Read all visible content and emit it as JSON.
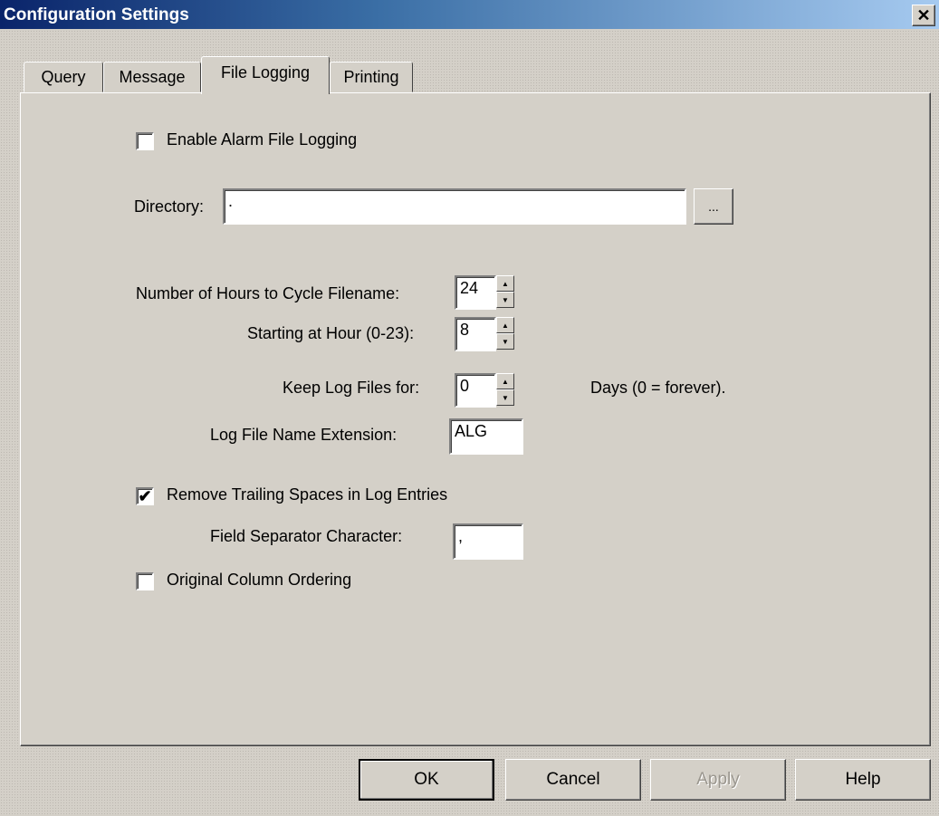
{
  "window": {
    "title": "Configuration Settings",
    "close_icon_glyph": "✕"
  },
  "tabs": [
    {
      "label": "Query",
      "active": false
    },
    {
      "label": "Message",
      "active": false
    },
    {
      "label": "File Logging",
      "active": true
    },
    {
      "label": "Printing",
      "active": false
    }
  ],
  "file_logging": {
    "enable_alarm_file_logging": {
      "label": "Enable Alarm File Logging",
      "checked": false
    },
    "directory": {
      "label": "Directory:",
      "value": ".",
      "browse_label": "..."
    },
    "cycle_hours": {
      "label": "Number of Hours to Cycle Filename:",
      "value": "24"
    },
    "starting_hour": {
      "label": "Starting at Hour (0-23):",
      "value": "8"
    },
    "keep_log_files": {
      "label": "Keep Log Files for:",
      "value": "0",
      "suffix": "Days (0 = forever)."
    },
    "log_extension": {
      "label": "Log File Name Extension:",
      "value": "ALG"
    },
    "remove_trailing_spaces": {
      "label": "Remove Trailing Spaces in Log Entries",
      "checked": true
    },
    "field_separator": {
      "label": "Field Separator Character:",
      "value": ","
    },
    "original_column_ordering": {
      "label": "Original Column Ordering",
      "checked": false
    }
  },
  "buttons": {
    "ok": "OK",
    "cancel": "Cancel",
    "apply": "Apply",
    "help": "Help"
  },
  "spin_glyphs": {
    "up": "▲",
    "down": "▼"
  },
  "check_glyph": "✔"
}
